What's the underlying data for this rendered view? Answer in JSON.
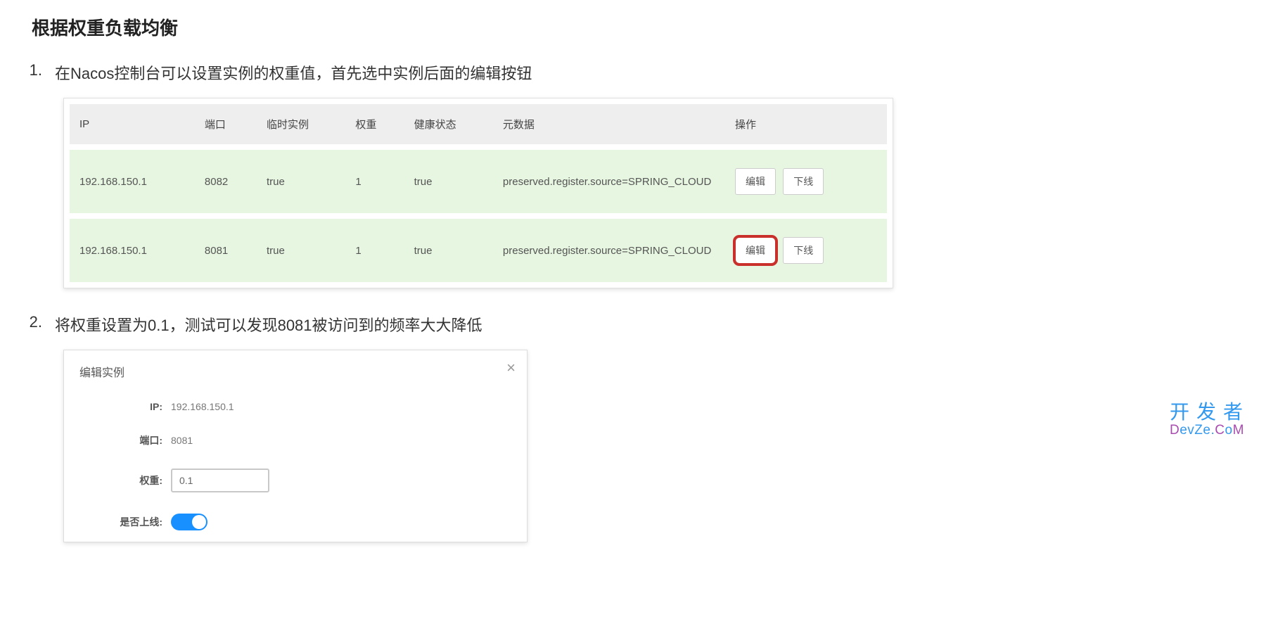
{
  "heading": "根据权重负载均衡",
  "steps": [
    {
      "num": "1.",
      "text": "在Nacos控制台可以设置实例的权重值，首先选中实例后面的编辑按钮"
    },
    {
      "num": "2.",
      "text": "将权重设置为0.1，测试可以发现8081被访问到的频率大大降低"
    }
  ],
  "table": {
    "headers": {
      "ip": "IP",
      "port": "端口",
      "ephemeral": "临时实例",
      "weight": "权重",
      "health": "健康状态",
      "metadata": "元数据",
      "actions": "操作"
    },
    "rows": [
      {
        "ip": "192.168.150.1",
        "port": "8082",
        "ephemeral": "true",
        "weight": "1",
        "health": "true",
        "metadata": "preserved.register.source=SPRING_CLOUD",
        "edit": "编辑",
        "offline": "下线",
        "highlight": false
      },
      {
        "ip": "192.168.150.1",
        "port": "8081",
        "ephemeral": "true",
        "weight": "1",
        "health": "true",
        "metadata": "preserved.register.source=SPRING_CLOUD",
        "edit": "编辑",
        "offline": "下线",
        "highlight": true
      }
    ]
  },
  "modal": {
    "title": "编辑实例",
    "ip_label": "IP:",
    "ip_value": "192.168.150.1",
    "port_label": "端口:",
    "port_value": "8081",
    "weight_label": "权重:",
    "weight_value": "0.1",
    "online_label": "是否上线:"
  },
  "watermark": {
    "cn": "开发者",
    "en_html": "DevZe.CoM"
  }
}
